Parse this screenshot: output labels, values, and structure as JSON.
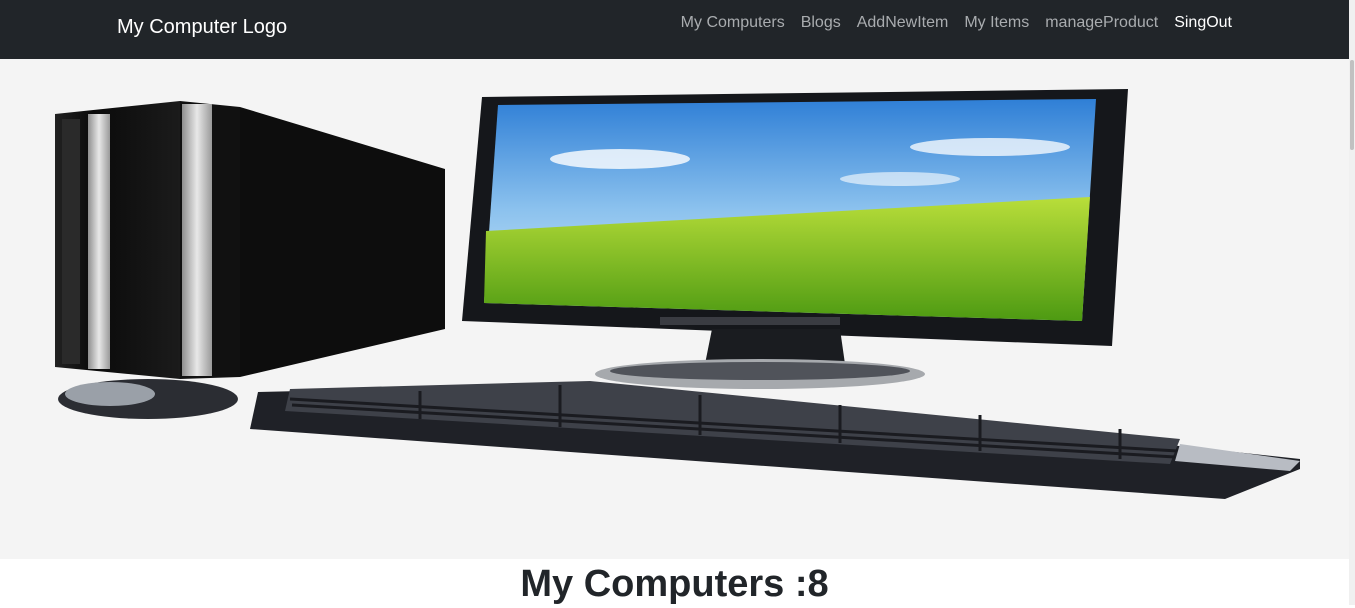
{
  "navbar": {
    "brand": "My Computer Logo",
    "links": [
      {
        "label": "My Computers"
      },
      {
        "label": "Blogs"
      },
      {
        "label": "AddNewItem"
      },
      {
        "label": "My Items"
      },
      {
        "label": "manageProduct"
      },
      {
        "label": "SingOut"
      }
    ]
  },
  "hero": {
    "image": "desktop-computer-banner"
  },
  "main": {
    "heading": "My Computers :8"
  },
  "colors": {
    "navbar_bg": "#212529",
    "nav_link": "#a9acaf",
    "nav_active": "#ffffff"
  }
}
